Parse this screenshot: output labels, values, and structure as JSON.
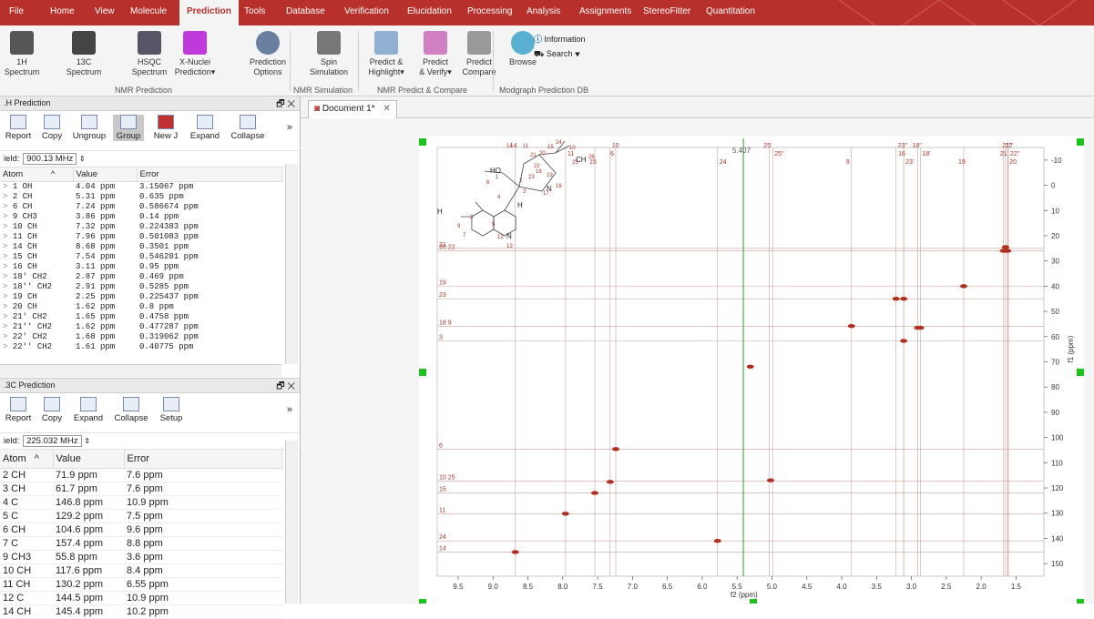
{
  "menu": {
    "items": [
      "File",
      "Home",
      "View",
      "Molecule",
      "Prediction",
      "Tools",
      "Database",
      "Verification",
      "Elucidation",
      "Processing",
      "Analysis",
      "Assignments",
      "StereoFitter",
      "Quantitation"
    ],
    "active": "Prediction"
  },
  "ribbon": {
    "buttons": [
      {
        "label": "1H\nSpectrum"
      },
      {
        "label": "13C\nSpectrum"
      },
      {
        "label": "HSQC\nSpectrum"
      },
      {
        "label": "X-Nuclei\nPrediction▾"
      },
      {
        "label": "Prediction\nOptions"
      },
      {
        "label": "Spin\nSimulation"
      },
      {
        "label": "Predict &\nHighlight▾"
      },
      {
        "label": "Predict\n& Verify▾"
      },
      {
        "label": "Predict\nCompare"
      },
      {
        "label": "Browse"
      }
    ],
    "information_label": "Information",
    "search_label": "Search ▾",
    "groups": [
      "NMR Prediction",
      "NMR Simulation",
      "NMR Predict & Compare",
      "Modgraph Prediction DB"
    ]
  },
  "h1_panel": {
    "title": ".H Prediction",
    "toolbar": [
      "Report",
      "Copy",
      "Ungroup",
      "Group",
      "New J",
      "Expand",
      "Collapse"
    ],
    "field_label": "ield:",
    "field_value": "900.13 MHz",
    "columns": [
      "Atom",
      "Value",
      "Error"
    ],
    "rows": [
      [
        "1 OH",
        "4.04 ppm",
        "3.15067 ppm"
      ],
      [
        "2 CH",
        "5.31 ppm",
        "0.635 ppm"
      ],
      [
        "6 CH",
        "7.24 ppm",
        "0.586674 ppm"
      ],
      [
        "9 CH3",
        "3.86 ppm",
        "0.14 ppm"
      ],
      [
        "10 CH",
        "7.32 ppm",
        "0.224383 ppm"
      ],
      [
        "11 CH",
        "7.96 ppm",
        "0.501083 ppm"
      ],
      [
        "14 CH",
        "8.68 ppm",
        "0.3501 ppm"
      ],
      [
        "15 CH",
        "7.54 ppm",
        "0.546201 ppm"
      ],
      [
        "16 CH",
        "3.11 ppm",
        "0.95 ppm"
      ],
      [
        "18' CH2",
        "2.87 ppm",
        "0.469 ppm"
      ],
      [
        "18'' CH2",
        "2.91 ppm",
        "0.5285 ppm"
      ],
      [
        "19 CH",
        "2.25 ppm",
        "0.225437 ppm"
      ],
      [
        "20 CH",
        "1.62 ppm",
        "0.8 ppm"
      ],
      [
        "21' CH2",
        "1.65 ppm",
        "0.4758 ppm"
      ],
      [
        "21'' CH2",
        "1.62 ppm",
        "0.477287 ppm"
      ],
      [
        "22' CH2",
        "1.68 ppm",
        "0.319062 ppm"
      ],
      [
        "22'' CH2",
        "1.61 ppm",
        "0.40775 ppm"
      ]
    ]
  },
  "c13_panel": {
    "title": ".3C Prediction",
    "toolbar": [
      "Report",
      "Copy",
      "Expand",
      "Collapse",
      "Setup"
    ],
    "field_label": "ield:",
    "field_value": "225.032 MHz",
    "columns": [
      "Atom",
      "Value",
      "Error"
    ],
    "rows": [
      [
        "2 CH",
        "71.9 ppm",
        "7.6 ppm"
      ],
      [
        "3 CH",
        "61.7 ppm",
        "7.6 ppm"
      ],
      [
        "4 C",
        "146.8 ppm",
        "10.9 ppm"
      ],
      [
        "5 C",
        "129.2 ppm",
        "7.5 ppm"
      ],
      [
        "6 CH",
        "104.6 ppm",
        "9.6 ppm"
      ],
      [
        "7 C",
        "157.4 ppm",
        "8.8 ppm"
      ],
      [
        "9 CH3",
        "55.8 ppm",
        "3.6 ppm"
      ],
      [
        "10 CH",
        "117.6 ppm",
        "8.4 ppm"
      ],
      [
        "11 CH",
        "130.2 ppm",
        "6.55 ppm"
      ],
      [
        "12 C",
        "144.5 ppm",
        "10.9 ppm"
      ],
      [
        "14 CH",
        "145.4 ppm",
        "10.2 ppm"
      ]
    ]
  },
  "document": {
    "tab_label": "Document 1*",
    "cursor_readout": "5.407",
    "x_axis_label": "f2 (ppm)",
    "y_axis_label": "f1 (ppm)",
    "x_ticks": [
      "9.5",
      "9.0",
      "8.5",
      "8.0",
      "7.5",
      "7.0",
      "6.5",
      "6.0",
      "5.5",
      "5.0",
      "4.5",
      "4.0",
      "3.5",
      "3.0",
      "2.5",
      "2.0",
      "1.5"
    ],
    "y_ticks": [
      "-10",
      "0",
      "10",
      "20",
      "30",
      "40",
      "50",
      "60",
      "70",
      "80",
      "90",
      "100",
      "110",
      "120",
      "130",
      "140",
      "150"
    ],
    "proton_labels": [
      {
        "text": "14",
        "ppm": 8.68
      },
      {
        "text": "11",
        "ppm": 7.96
      },
      {
        "text": "15",
        "ppm": 7.54
      },
      {
        "text": "10",
        "ppm": 7.32
      },
      {
        "text": "6",
        "ppm": 7.24
      },
      {
        "text": "24",
        "ppm": 5.78
      },
      {
        "text": "25'",
        "ppm": 5.04
      },
      {
        "text": "25''",
        "ppm": 4.99
      },
      {
        "text": "9",
        "ppm": 3.86
      },
      {
        "text": "23''",
        "ppm": 3.22
      },
      {
        "text": "16",
        "ppm": 3.11
      },
      {
        "text": "23'",
        "ppm": 3.11
      },
      {
        "text": "18''",
        "ppm": 2.91
      },
      {
        "text": "18'",
        "ppm": 2.87
      },
      {
        "text": "19",
        "ppm": 2.25
      },
      {
        "text": "22'",
        "ppm": 1.68
      },
      {
        "text": "21'",
        "ppm": 1.65
      },
      {
        "text": "20",
        "ppm": 1.62
      },
      {
        "text": "21''",
        "ppm": 1.62
      },
      {
        "text": "22''",
        "ppm": 1.61
      }
    ],
    "carbon_labels": [
      {
        "text": "20 22",
        "ppm": 26
      },
      {
        "text": "21",
        "ppm": 25
      },
      {
        "text": "19",
        "ppm": 40
      },
      {
        "text": "23",
        "ppm": 45
      },
      {
        "text": "18 9",
        "ppm": 56
      },
      {
        "text": "3",
        "ppm": 61.7
      },
      {
        "text": "6",
        "ppm": 104.6
      },
      {
        "text": "10 25",
        "ppm": 117.3
      },
      {
        "text": "15",
        "ppm": 122
      },
      {
        "text": "11",
        "ppm": 130.2
      },
      {
        "text": "24",
        "ppm": 141
      },
      {
        "text": "14",
        "ppm": 145.4
      }
    ],
    "molecule_labels": {
      "ho": "HO",
      "h3c": "H",
      "ch2": "CH",
      "h": "H",
      "n_quinoline": "N",
      "n_bridge": "N",
      "atoms": [
        "14",
        "11",
        "21",
        "20",
        "15",
        "10",
        "26",
        "6",
        "19",
        "22",
        "23",
        "1",
        "2",
        "3",
        "16",
        "17",
        "4",
        "8",
        "5",
        "7",
        "9",
        "12",
        "13",
        "24",
        "25",
        "18"
      ]
    }
  },
  "chart_data": {
    "type": "scatter",
    "title": "",
    "xlabel": "f2 (ppm)",
    "ylabel": "f1 (ppm)",
    "xlim": [
      9.8,
      1.1
    ],
    "ylim": [
      -15,
      155
    ],
    "grid": false,
    "series": [
      {
        "values": [
          {
            "x": 8.68,
            "y": 145.4
          },
          {
            "x": 7.96,
            "y": 130.2
          },
          {
            "x": 7.54,
            "y": 122.0
          },
          {
            "x": 7.32,
            "y": 117.6
          },
          {
            "x": 7.24,
            "y": 104.6
          },
          {
            "x": 5.78,
            "y": 141.0
          },
          {
            "x": 5.31,
            "y": 71.9
          },
          {
            "x": 5.02,
            "y": 117.0
          },
          {
            "x": 3.86,
            "y": 55.8
          },
          {
            "x": 3.22,
            "y": 45.0
          },
          {
            "x": 3.11,
            "y": 45.0
          },
          {
            "x": 3.11,
            "y": 61.7
          },
          {
            "x": 2.91,
            "y": 56.5
          },
          {
            "x": 2.87,
            "y": 56.5
          },
          {
            "x": 2.25,
            "y": 40.0
          },
          {
            "x": 1.65,
            "y": 24.5
          },
          {
            "x": 1.62,
            "y": 26.0
          },
          {
            "x": 1.68,
            "y": 26.0
          }
        ]
      }
    ]
  },
  "colors": {
    "menubar": "#b8302b",
    "peak": "#b03020",
    "cursor": "#2ca02c",
    "label": "#a0342b"
  }
}
